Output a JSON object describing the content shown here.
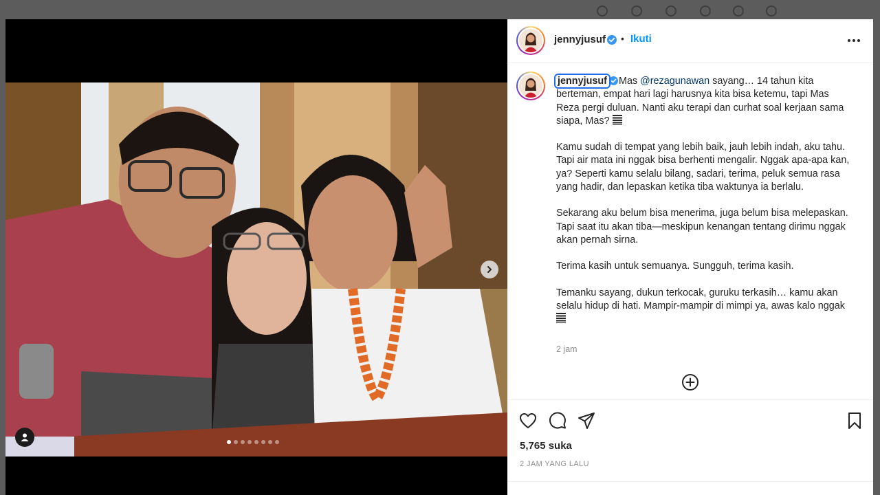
{
  "post": {
    "username": "jennyjusuf",
    "separator": "•",
    "follow_label": "Ikuti",
    "caption": {
      "username": "jennyjusuf",
      "p1_prefix": "Mas ",
      "mention": "@rezagunawan",
      "p1_text": " sayang… 14 tahun kita berteman, empat hari lagi harusnya kita bisa ketemu, tapi Mas Reza pergi duluan. Nanti aku terapi dan curhat soal kerjaan sama siapa, Mas? ",
      "p2": "Kamu sudah di tempat yang lebih baik, jauh lebih indah, aku tahu. Tapi air mata ini nggak bisa berhenti mengalir. Nggak apa-apa kan, ya? Seperti kamu selalu bilang, sadari, terima, peluk semua rasa yang hadir, dan lepaskan ketika tiba waktunya ia berlalu.",
      "p3": "Sekarang aku belum bisa menerima, juga belum bisa melepaskan. Tapi saat itu akan tiba—meskipun kenangan tentang dirimu nggak akan pernah sirna.",
      "p4": "Terima kasih untuk semuanya. Sungguh, terima kasih.",
      "p5": "Temanku sayang, dukun terkocak, guruku terkasih… kamu akan selalu hidup di hati. Mampir-mampir di mimpi ya, awas kalo nggak "
    },
    "caption_time": "2 jam",
    "likes": "5,765 suka",
    "posted_time": "2 JAM YANG LALU"
  },
  "carousel": {
    "count": 8,
    "active_index": 0
  },
  "colors": {
    "accent": "#0095f6",
    "verified": "#3897f0",
    "mention": "#00376b",
    "muted": "#8e8e8e"
  },
  "icons": [
    "heart-icon",
    "comment-icon",
    "share-icon",
    "bookmark-icon",
    "more-icon",
    "verified-icon",
    "chevron-right-icon",
    "user-tag-icon",
    "add-circle-icon"
  ]
}
